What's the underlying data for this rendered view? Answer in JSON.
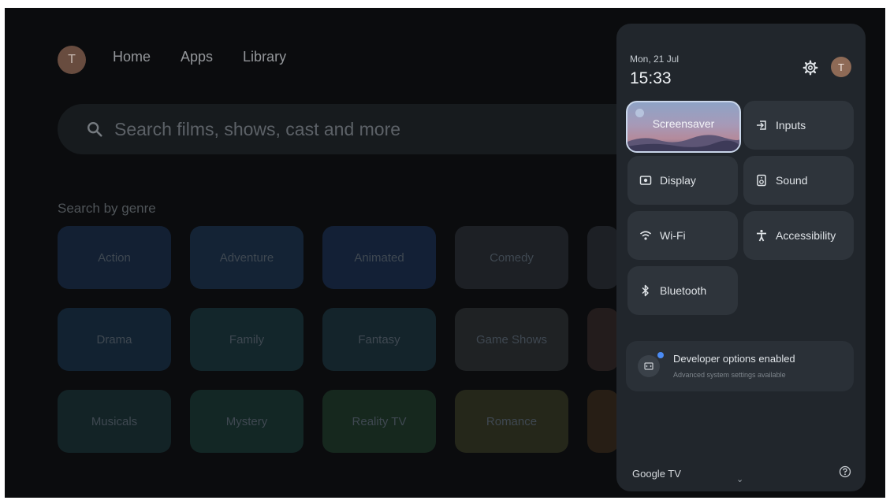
{
  "home": {
    "avatar_initial": "T",
    "nav": [
      "Home",
      "Apps",
      "Library"
    ],
    "search_placeholder": "Search films, shows, cast and more",
    "genre_title": "Search by genre",
    "genres": [
      {
        "label": "Action",
        "color": "#17263d"
      },
      {
        "label": "Adventure",
        "color": "#182a3f"
      },
      {
        "label": "Animated",
        "color": "#172640"
      },
      {
        "label": "Comedy",
        "color": "#23262c"
      },
      {
        "label": "Drama",
        "color": "#16293a"
      },
      {
        "label": "Family",
        "color": "#172d33"
      },
      {
        "label": "Fantasy",
        "color": "#182b33"
      },
      {
        "label": "Game Shows",
        "color": "#25282b"
      },
      {
        "label": "Musicals",
        "color": "#172a2d"
      },
      {
        "label": "Mystery",
        "color": "#172e2c"
      },
      {
        "label": "Reality TV",
        "color": "#1b3024"
      },
      {
        "label": "Romance",
        "color": "#2c2e1f"
      }
    ]
  },
  "panel": {
    "date": "Mon, 21 Jul",
    "time": "15:33",
    "avatar_initial": "T",
    "tiles": {
      "screensaver": "Screensaver",
      "inputs": "Inputs",
      "display": "Display",
      "sound": "Sound",
      "wifi": "Wi-Fi",
      "accessibility": "Accessibility",
      "bluetooth": "Bluetooth"
    },
    "developer": {
      "title": "Developer options enabled",
      "subtitle": "Advanced system settings available"
    },
    "footer_brand": "Google TV",
    "footer_chevron": "⌄"
  }
}
